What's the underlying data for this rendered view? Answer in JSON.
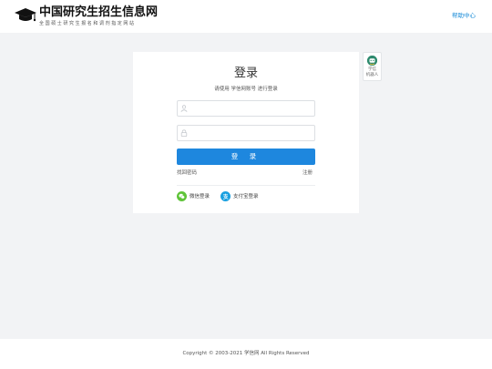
{
  "header": {
    "title": "中国研究生招生信息网",
    "subtitle": "全国硕士研究生报名和调剂指定网站",
    "help_link": "帮助中心"
  },
  "login": {
    "title": "登录",
    "subtitle": "请使用 学信网账号 进行登录",
    "username": {
      "value": "",
      "placeholder": ""
    },
    "password": {
      "value": "",
      "placeholder": ""
    },
    "submit_label": "登 录",
    "forgot_label": "找回密码",
    "register_label": "注册",
    "social": [
      {
        "label": "微信登录",
        "icon": "wechat-icon",
        "color": "#5fc439"
      },
      {
        "label": "支付宝登录",
        "icon": "alipay-icon",
        "color": "#1aa0e0"
      }
    ]
  },
  "robot": {
    "line1": "学信",
    "line2": "机器人"
  },
  "footer": {
    "copyright": "Copyright © 2003-2021 学信网 All Rights Reserved"
  },
  "colors": {
    "accent": "#1e87de",
    "page_bg": "#f2f3f5",
    "link": "#1a8cd8"
  }
}
